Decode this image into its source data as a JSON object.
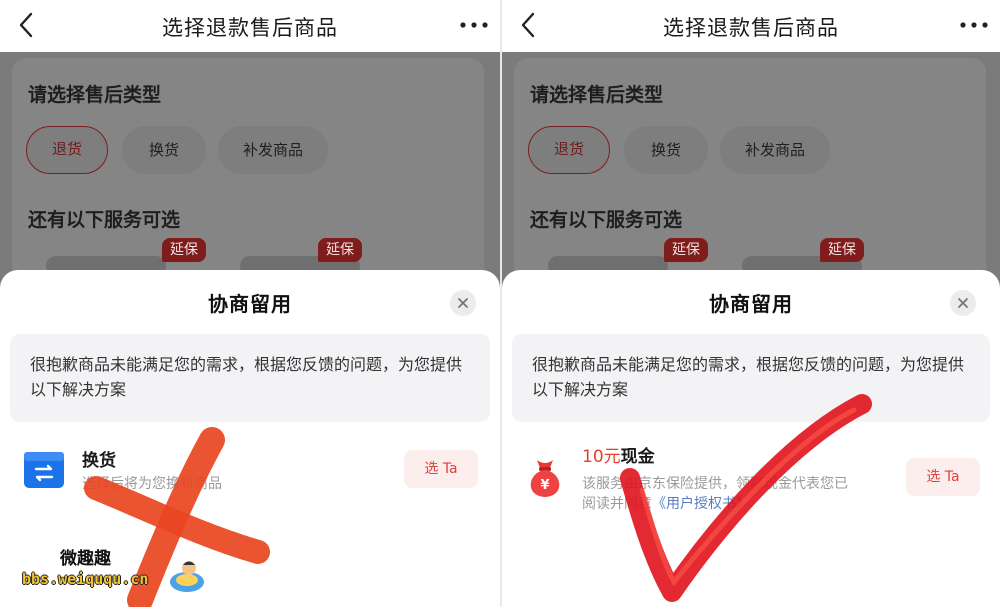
{
  "nav": {
    "title": "选择退款售后商品"
  },
  "page": {
    "type_section_title": "请选择售后类型",
    "types": [
      {
        "label": "退货",
        "selected": true
      },
      {
        "label": "换货",
        "selected": false
      },
      {
        "label": "补发商品",
        "selected": false
      }
    ],
    "service_section_title": "还有以下服务可选",
    "service_tags": [
      "延保",
      "延保"
    ]
  },
  "sheet": {
    "title": "协商留用",
    "message": "很抱歉商品未能满足您的需求，根据您反馈的问题，为您提供以下解决方案"
  },
  "left_option": {
    "icon": "exchange-icon",
    "title": "换货",
    "desc": "选择后将为您换新商品",
    "button": "选 Ta",
    "overlay": "red-x-mark"
  },
  "right_option": {
    "icon": "money-bag-icon",
    "title_amount": "10元",
    "title_text": "现金",
    "desc": "该服务由京东保险提供，领取现金代表您已阅读并同意",
    "desc_link": "《用户授权书》",
    "button": "选 Ta",
    "overlay": "red-check-mark"
  },
  "watermark": {
    "line1": "微趣趣",
    "line2": "bbs.weiququ.cn"
  },
  "colors": {
    "accent": "#e0403a",
    "link": "#5b7cc4",
    "mark_red": "#e8451f",
    "check_red": "#e0121c"
  }
}
